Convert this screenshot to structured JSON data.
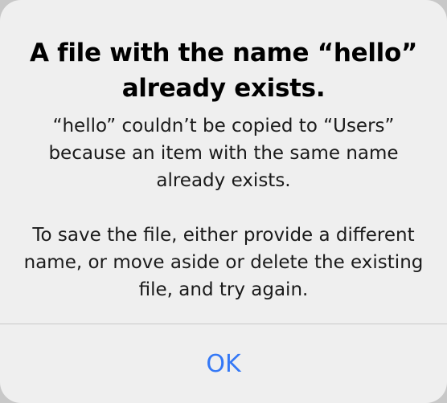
{
  "alert": {
    "title_line1": "A file with the name “hello”",
    "title_line2": "already exists.",
    "message_para1": "“hello” couldn’t be copied to “Users” because an item with the same name already exists.",
    "message_para2": "To save the file, either provide a different name, or move aside or delete the existing file, and try again.",
    "ok_label": "OK"
  },
  "colors": {
    "background": "#efefef",
    "accent": "#3478f6",
    "divider": "#c9c9c9"
  }
}
